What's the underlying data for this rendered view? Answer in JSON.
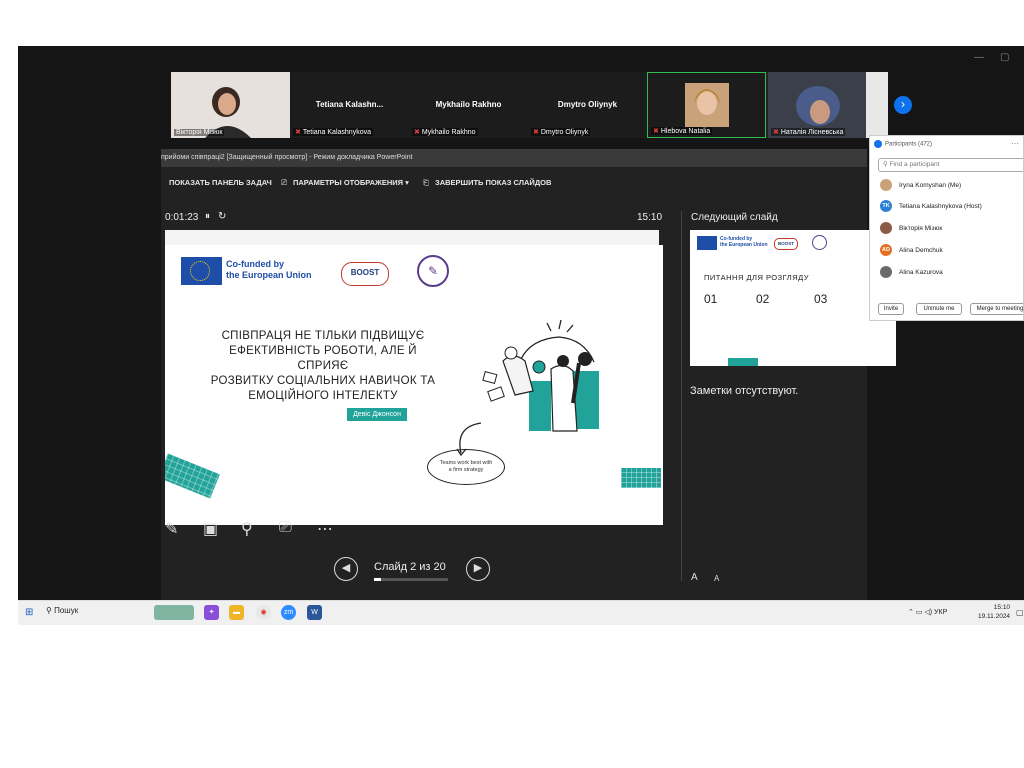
{
  "gallery": {
    "tiles": [
      {
        "name": "",
        "label": "Вікторія Мізюк"
      },
      {
        "name": "Tetiana  Kalashn...",
        "label": "Tetiana Kalashnykova"
      },
      {
        "name": "Mykhailo Rakhno",
        "label": "Mykhailo Rakhno"
      },
      {
        "name": "Dmytro Oliynyk",
        "label": "Dmytro Oliynyk"
      },
      {
        "name": "",
        "label": "Hlebova Natalia"
      },
      {
        "name": "",
        "label": "Наталія Лісневська"
      }
    ]
  },
  "presenter": {
    "window_title": "прийоми співпраці2 [Защищенный просмотр] - Режим докладчика PowerPoint",
    "toolbar": {
      "taskbar": "ПОКАЗАТЬ ПАНЕЛЬ ЗАДАЧ",
      "display": "ПАРАМЕТРЫ ОТОБРАЖЕНИЯ ▾",
      "end": "ЗАВЕРШИТЬ ПОКАЗ СЛАЙДОВ"
    },
    "timer": "0:01:23",
    "clock": "15:10",
    "next_slide_label": "Следующий слайд",
    "slide_counter": "Слайд 2 из 20",
    "progress_fraction": 0.1,
    "notes": "Заметки отсутствуют.",
    "font_buttons": [
      "A",
      "A"
    ]
  },
  "slide": {
    "eu_line1": "Co-funded by",
    "eu_line2": "the European Union",
    "boost": "BOOST",
    "text_line1": "СПІВПРАЦЯ НЕ ТІЛЬКИ ПІДВИЩУЄ",
    "text_line2": "ЕФЕКТИВНІСТЬ РОБОТИ, АЛЕ Й СПРИЯЄ",
    "text_line3": "РОЗВИТКУ СОЦІАЛЬНИХ НАВИЧОК ТА",
    "text_line4": "ЕМОЦІЙНОГО ІНТЕЛЕКТУ",
    "author": "Девіс Джонсон",
    "bubble_line1": "Teams work best with",
    "bubble_line2": "a firm strategy"
  },
  "next_slide": {
    "eu_line1": "Co-funded by",
    "eu_line2": "the European Union",
    "boost": "BOOST",
    "heading": "ПИТАННЯ ДЛЯ РОЗГЛЯДУ",
    "nums": [
      "01",
      "02",
      "03"
    ]
  },
  "participants": {
    "title": "Participants (472)",
    "search_placeholder": "Find a participant",
    "items": [
      {
        "initials": "",
        "name": "Iryna Komyshan (Me)",
        "color": "#c9a27a"
      },
      {
        "initials": "TK",
        "name": "Tetiana Kalashnykova (Host)",
        "color": "#2d7fd3"
      },
      {
        "initials": "",
        "name": "Вікторія Мізюк",
        "color": "#8a5a44"
      },
      {
        "initials": "AD",
        "name": "Alina Demchuk",
        "color": "#e36f24"
      },
      {
        "initials": "",
        "name": "Alina Kazurova",
        "color": "#6a6a6a"
      }
    ],
    "buttons": {
      "invite": "Invite",
      "unmute": "Unmute me",
      "merge": "Merge to meeting"
    }
  },
  "taskbar": {
    "search": "Пошук",
    "lang": "УКР",
    "time": "15:10",
    "date": "19.11.2024"
  }
}
